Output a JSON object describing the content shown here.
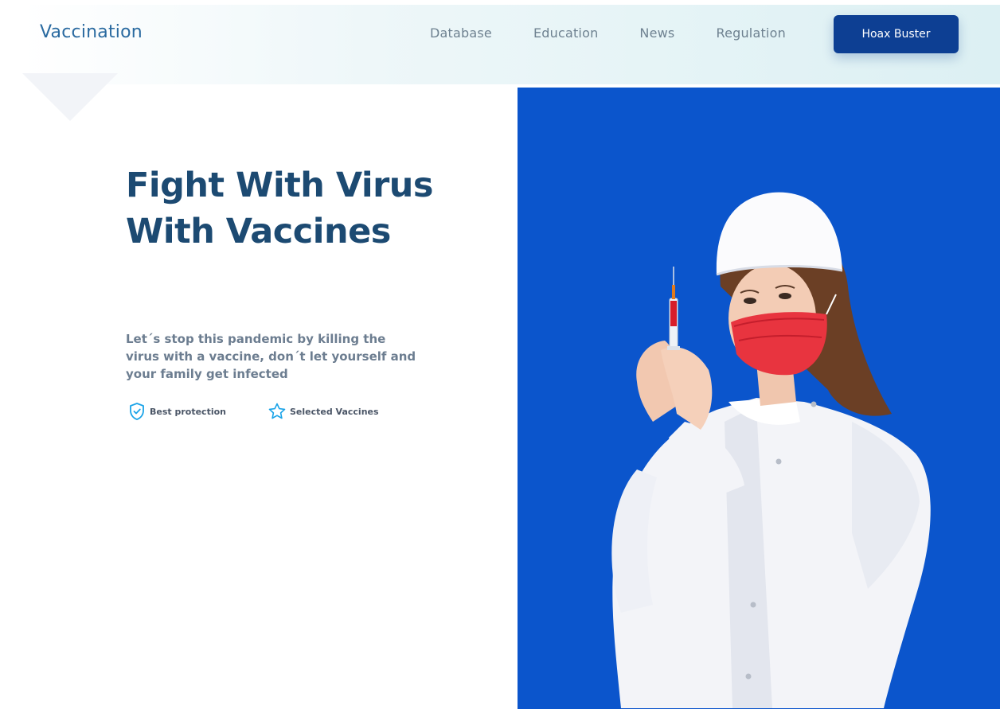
{
  "header": {
    "logo": "Vaccination",
    "nav": [
      {
        "label": "Database"
      },
      {
        "label": "Education"
      },
      {
        "label": "News"
      },
      {
        "label": "Regulation"
      }
    ],
    "cta_label": "Hoax Buster"
  },
  "hero": {
    "title_line1": "Fight With Virus",
    "title_line2": "With Vaccines",
    "description": "Let´s stop this pandemic by killing the virus with a vaccine, don´t let yourself and your family get infected",
    "features": [
      {
        "icon": "shield-check-icon",
        "label": "Best protection"
      },
      {
        "icon": "star-icon",
        "label": "Selected Vaccines"
      }
    ]
  },
  "colors": {
    "brand_dark": "#0d3f93",
    "title": "#1c4a72",
    "icon_accent": "#1aa3e8",
    "photo_background": "#0b55cc"
  }
}
